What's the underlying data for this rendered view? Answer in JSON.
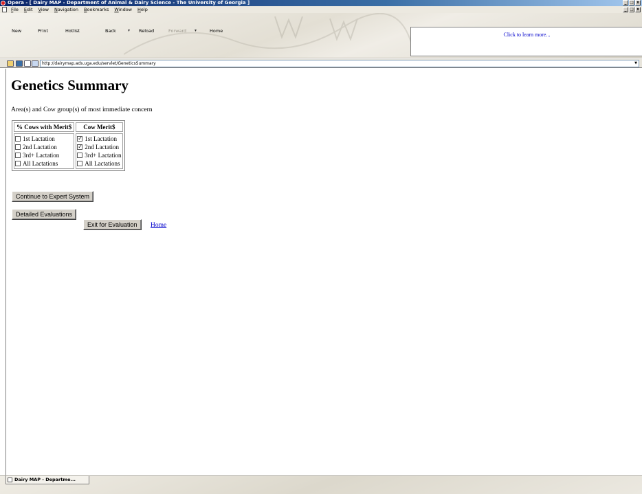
{
  "window": {
    "title": "Opera - [ Dairy MAP - Department of Animal & Dairy Science - The University of Georgia ]",
    "controls": [
      "_",
      "□",
      "x"
    ],
    "mdi_controls": [
      "_",
      "□",
      "x"
    ]
  },
  "menu": {
    "items": [
      "File",
      "Edit",
      "View",
      "Navigation",
      "Bookmarks",
      "Window",
      "Help"
    ]
  },
  "toolbar": {
    "new_label": "New",
    "print_label": "Print",
    "hotlist_label": "Hotlist",
    "back_label": "Back",
    "reload_label": "Reload",
    "forward_label": "Forward",
    "home_label": "Home",
    "ad_text": "Click to learn more..."
  },
  "address": {
    "url": "http://dairymap.ads.uga.edu/servlet/GeneticsSummary"
  },
  "page": {
    "title": "Genetics Summary",
    "intro": "Area(s) and Cow group(s) of most immediate concern",
    "table": {
      "col1_header": "% Cows with Merit$",
      "col2_header": "Cow Merit$",
      "col1_items": [
        {
          "label": "1st Lactation",
          "checked": false
        },
        {
          "label": "2nd Lactation",
          "checked": false
        },
        {
          "label": "3rd+ Lactation",
          "checked": false
        },
        {
          "label": "All Lactations",
          "checked": false
        }
      ],
      "col2_items": [
        {
          "label": "1st Lactation",
          "checked": true
        },
        {
          "label": "2nd Lactation",
          "checked": true
        },
        {
          "label": "3rd+ Lactation",
          "checked": false
        },
        {
          "label": "All Lactations",
          "checked": false
        }
      ]
    },
    "buttons": {
      "continue_label": "Continue to Expert System",
      "detailed_label": "Detailed Evaluations",
      "exit_label": "Exit for Evaluation"
    },
    "home_link": "Home"
  },
  "taskbar": {
    "tab_label": "Dairy MAP - Departme..."
  }
}
